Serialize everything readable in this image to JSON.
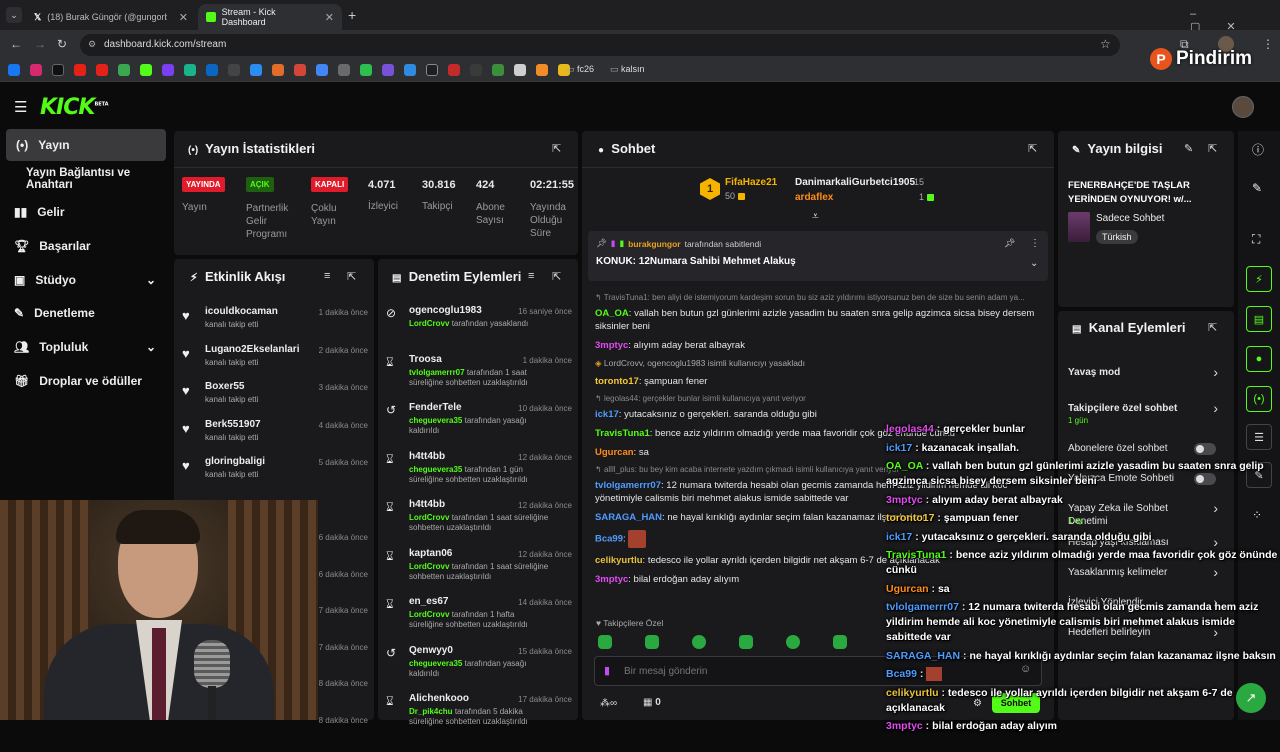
{
  "browser": {
    "tabs": [
      {
        "label": "(18) Burak Güngör (@gungorbu"
      },
      {
        "label": "Stream - Kick Dashboard"
      }
    ],
    "url": "dashboard.kick.com/stream",
    "bookmarks": [
      "fc26",
      "kalsın"
    ]
  },
  "watermark": "Pindirim",
  "header": {
    "logo": "KICK",
    "beta": "BETA"
  },
  "sidebar": {
    "items": [
      {
        "label": "Yayın"
      },
      {
        "label": "Yayın Bağlantısı ve Anahtarı"
      },
      {
        "label": "Gelir"
      },
      {
        "label": "Başarılar"
      },
      {
        "label": "Stüdyo"
      },
      {
        "label": "Denetleme"
      },
      {
        "label": "Topluluk"
      },
      {
        "label": "Droplar ve ödüller"
      }
    ]
  },
  "stats": {
    "title": "Yayın İstatistikleri",
    "badges": [
      {
        "badge": "YAYINDA",
        "label": "Yayın",
        "color": "#e01b2b"
      },
      {
        "badge": "AÇIK",
        "label": "Partnerlik Gelir Programı",
        "color": "#53fc18"
      },
      {
        "badge": "KAPALI",
        "label": "Çoklu Yayın",
        "color": "#e01b2b"
      }
    ],
    "values": [
      {
        "value": "4.071",
        "label": "İzleyici"
      },
      {
        "value": "30.816",
        "label": "Takipçi"
      },
      {
        "value": "424",
        "label": "Abone Sayısı"
      },
      {
        "value": "02:21:55",
        "label": "Yayında Olduğu Süre"
      }
    ]
  },
  "activity": {
    "title": "Etkinlik Akışı",
    "items": [
      {
        "name": "icouldkocaman",
        "desc": "kanalı takip etti",
        "time": "1 dakika önce"
      },
      {
        "name": "Lugano2Ekselanlari",
        "desc": "kanalı takip etti",
        "time": "2 dakika önce"
      },
      {
        "name": "Boxer55",
        "desc": "kanalı takip etti",
        "time": "3 dakika önce"
      },
      {
        "name": "Berk551907",
        "desc": "kanalı takip etti",
        "time": "4 dakika önce"
      },
      {
        "name": "gloringbaligi",
        "desc": "kanalı takip etti",
        "time": "5 dakika önce"
      }
    ],
    "hidden_times": [
      "6 dakika önce",
      "6 dakika önce",
      "7 dakika önce",
      "7 dakika önce",
      "8 dakika önce",
      "8 dakika önce"
    ]
  },
  "moderation": {
    "title": "Denetim Eylemleri",
    "items": [
      {
        "name": "ogencoglu1983",
        "mod": "LordCrovv",
        "desc": "tarafından yasaklandı",
        "time": "16 saniye önce",
        "icon": "ban"
      },
      {
        "name": "Troosa",
        "mod": "tvlolgamerrr07",
        "desc": "tarafından 1 saat süreliğine sohbetten uzaklaştırıldı",
        "time": "1 dakika önce",
        "icon": "timeout"
      },
      {
        "name": "FenderTele",
        "mod": "cheguevera35",
        "desc": "tarafından yasağı kaldırıldı",
        "time": "10 dakika önce",
        "icon": "undo"
      },
      {
        "name": "h4tt4bb",
        "mod": "cheguevera35",
        "desc": "tarafından 1 gün süreliğine sohbetten uzaklaştırıldı",
        "time": "12 dakika önce",
        "icon": "timeout"
      },
      {
        "name": "h4tt4bb",
        "mod": "LordCrovv",
        "desc": "tarafından 1 saat süreliğine sohbetten uzaklaştırıldı",
        "time": "12 dakika önce",
        "icon": "timeout"
      },
      {
        "name": "kaptan06",
        "mod": "LordCrovv",
        "desc": "tarafından 1 saat süreliğine sohbetten uzaklaştırıldı",
        "time": "12 dakika önce",
        "icon": "timeout"
      },
      {
        "name": "en_es67",
        "mod": "LordCrovv",
        "desc": "tarafından 1 hafta süreliğine sohbetten uzaklaştırıldı",
        "time": "14 dakika önce",
        "icon": "timeout"
      },
      {
        "name": "Qenwyy0",
        "mod": "cheguevera35",
        "desc": "tarafından yasağı kaldırıldı",
        "time": "15 dakika önce",
        "icon": "undo"
      },
      {
        "name": "Alichenkooo",
        "mod": "Dr_pik4chu",
        "desc": "tarafından 5 dakika süreliğine sohbetten uzaklaştırıldı",
        "time": "17 dakika önce",
        "icon": "timeout"
      }
    ]
  },
  "chat": {
    "title": "Sohbet",
    "top": {
      "rank": "1",
      "user1": "FifaHaze21",
      "count1": "50",
      "user2": "DanimarkaliGurbetci1905",
      "count2": "15",
      "user3": "ardaflex",
      "count3": "1"
    },
    "pinned": {
      "by": "burakgungor",
      "by_suffix": "tarafından sabitlendi",
      "text": "KONUK: 12Numara Sahibi Mehmet Alakuş"
    },
    "messages": [
      {
        "reply": "TravisTuna1: ben aliyi de istemiyorum kardeşim sorun bu siz aziz yıldırımı istiyorsunuz ben de size bu senin adam ya..."
      },
      {
        "user": "OA_OA",
        "color": "#53fc18",
        "text": "vallah ben butun gzl günlerimi azizle yasadim bu saaten snra gelip agzimca sicsa bisey dersem siksinler beni"
      },
      {
        "user": "3mptyc",
        "color": "#e14cf0",
        "text": "alıyım aday berat albayrak"
      },
      {
        "system": "LordCrovv, ogencoglu1983 isimli kullanıcıyı yasakladı"
      },
      {
        "user": "toronto17",
        "color": "#f8c63a",
        "text": "şampuan fener"
      },
      {
        "reply": "legolas44: gerçekler bunlar isimli kullanıcıya yanıt veriyor"
      },
      {
        "user": "ick17",
        "color": "#4f9cff",
        "text": "yutacaksınız o gerçekleri. saranda olduğu gibi"
      },
      {
        "user": "TravisTuna1",
        "color": "#53fc18",
        "text": "bence aziz yıldırım olmadığı yerde maa favoridir çok göz önünde cünkü"
      },
      {
        "user": "Ugurcan",
        "color": "#ff8c1a",
        "text": "sa"
      },
      {
        "reply": "allll_plus: bu bey kim acaba internete yazdım çıkmadı isimli kullanıcıya yanıt veriyor"
      },
      {
        "user": "tvlolgamerrr07",
        "color": "#4f9cff",
        "text": "12 numara twiterda hesabi olan gecmis zamanda hem aziz yildirim hemde ali koc yönetimiyle calismis biri mehmet alakus ismide sabittede var"
      },
      {
        "user": "SARAGA_HAN",
        "color": "#4f9cff",
        "text": "ne hayal kırıklığı aydınlar seçim falan kazanamaz ilşne baksın"
      },
      {
        "user": "Bca99",
        "color": "#4f9cff",
        "text": ""
      },
      {
        "user": "celikyurtlu",
        "color": "#e8c33a",
        "text": "tedesco ile yollar ayrıldı içerden bilgidir net akşam 6-7 de açıklanacak"
      },
      {
        "user": "3mptyc",
        "color": "#e14cf0",
        "text": "bilal erdoğan aday alıyım"
      }
    ],
    "followers_only": "Takipçilere Özel",
    "input_placeholder": "Bir mesaj gönderin",
    "viewer_count": "0",
    "send_label": "Sohbet"
  },
  "stream_info": {
    "title": "Yayın bilgisi",
    "stream_title": "FENERBAHÇE'DE TAŞLAR YERİNDEN OYNUYOR! w/...",
    "mode": "Sadece Sohbet",
    "lang": "Türkish"
  },
  "channel_actions": {
    "title": "Kanal Eylemleri",
    "items": [
      {
        "label": "Yavaş mod",
        "sub": ""
      },
      {
        "label": "Takipçilere özel sohbet",
        "sub": "1 gün"
      },
      {
        "label": "Abonelere özel sohbet",
        "sub": ""
      },
      {
        "label": "Yalnızca Emote Sohbeti",
        "sub": ""
      },
      {
        "label": "Yapay Zeka ile Sohbet Denetimi",
        "sub": "1 ay"
      },
      {
        "label": "Hesap yaşı kısıtlaması",
        "sub": ""
      },
      {
        "label": "Yasaklanmış kelimeler",
        "sub": ""
      },
      {
        "label": "İzleyici Yönlendir",
        "sub": ""
      },
      {
        "label": "Hedefleri belirleyin",
        "sub": ""
      }
    ]
  },
  "overlay": [
    {
      "user": "legolas44",
      "color": "#e14cf0",
      "text": "gerçekler bunlar"
    },
    {
      "user": "ick17",
      "color": "#4f9cff",
      "text": "kazanacak inşallah."
    },
    {
      "user": "OA_OA",
      "color": "#53fc18",
      "text": "vallah ben butun gzl günlerimi azizle yasadim bu saaten snra gelip agzimca sicsa bisey dersem siksinler beni"
    },
    {
      "user": "3mptyc",
      "color": "#e14cf0",
      "text": "alıyım aday berat albayrak"
    },
    {
      "user": "toronto17",
      "color": "#f8c63a",
      "text": "şampuan fener"
    },
    {
      "user": "ick17",
      "color": "#4f9cff",
      "text": "yutacaksınız o gerçekleri. saranda olduğu gibi"
    },
    {
      "user": "TravisTuna1",
      "color": "#53fc18",
      "text": "bence aziz yıldırım olmadığı yerde maa favoridir çok göz önünde cünkü"
    },
    {
      "user": "Ugurcan",
      "color": "#ff8c1a",
      "text": "sa"
    },
    {
      "user": "tvlolgamerrr07",
      "color": "#4f9cff",
      "text": "12 numara twiterda hesabi olan gecmis zamanda hem aziz yildirim hemde ali koc yönetimiyle calismis biri mehmet alakus ismide sabittede var"
    },
    {
      "user": "SARAGA_HAN",
      "color": "#4f9cff",
      "text": "ne hayal kırıklığı aydınlar seçim falan kazanamaz ilşne baksın"
    },
    {
      "user": "Bca99",
      "color": "#4f9cff",
      "text": ""
    },
    {
      "user": "celikyurtlu",
      "color": "#e8c33a",
      "text": "tedesco ile yollar ayrıldı içerden bilgidir net akşam 6-7 de açıklanacak"
    },
    {
      "user": "3mptyc",
      "color": "#e14cf0",
      "text": "bilal erdoğan aday alıyım"
    }
  ]
}
